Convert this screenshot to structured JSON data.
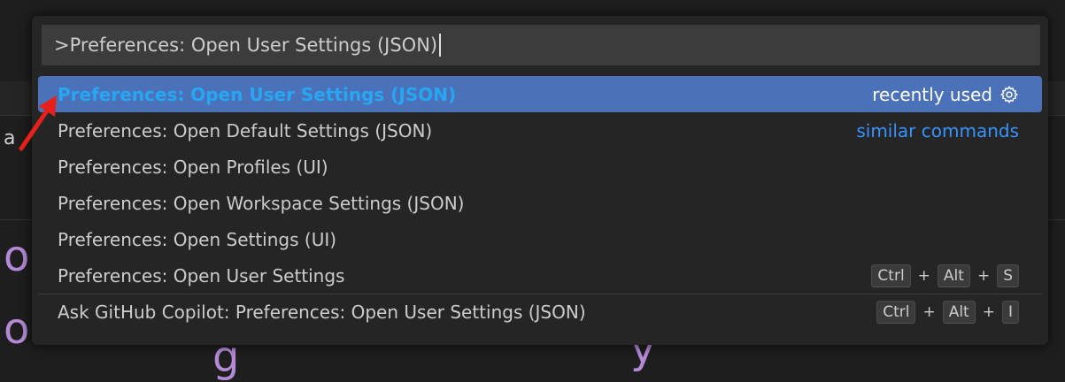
{
  "background": {
    "side_text": "a",
    "big_glyph_1": "o",
    "big_glyph_2": "o",
    "fragment_g": "g",
    "fragment_y": "y"
  },
  "palette": {
    "input_value": ">Preferences: Open User Settings (JSON)",
    "items": [
      {
        "label": "Preferences: Open User Settings (JSON)",
        "detail": "recently used",
        "icon": "gear-icon"
      },
      {
        "label": "Preferences: Open Default Settings (JSON)",
        "detail": "similar commands"
      },
      {
        "label": "Preferences: Open Profiles (UI)"
      },
      {
        "label": "Preferences: Open Workspace Settings (JSON)"
      },
      {
        "label": "Preferences: Open Settings (UI)"
      },
      {
        "label": "Preferences: Open User Settings",
        "keys": [
          "Ctrl",
          "Alt",
          "S"
        ]
      },
      {
        "label": "Ask GitHub Copilot: Preferences: Open User Settings (JSON)",
        "keys": [
          "Ctrl",
          "Alt",
          "I"
        ]
      }
    ],
    "key_separator": "+"
  },
  "colors": {
    "selection": "#4b71b8",
    "selected_label": "#27a7f3",
    "link": "#3794ff",
    "annotation_arrow": "#e8201b"
  }
}
